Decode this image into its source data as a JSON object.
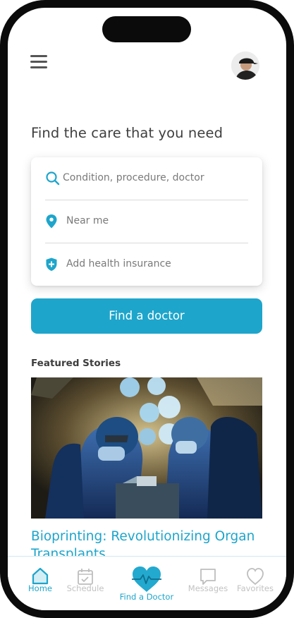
{
  "header": {
    "menu_icon": "hamburger-menu-icon",
    "avatar_icon": "user-avatar"
  },
  "main": {
    "title": "Find the care that you need",
    "search": {
      "condition_placeholder": "Condition, procedure, doctor",
      "location_placeholder": "Near me",
      "insurance_placeholder": "Add health insurance"
    },
    "find_button_label": "Find a doctor"
  },
  "featured": {
    "section_label": "Featured Stories",
    "story": {
      "image_icon": "surgeons-operating-photo",
      "title": "Bioprinting: Revolutionizing Organ Transplants"
    }
  },
  "tabbar": {
    "items": [
      {
        "label": "Home",
        "icon": "home-icon",
        "active": true
      },
      {
        "label": "Schedule",
        "icon": "calendar-check-icon",
        "active": false
      },
      {
        "label": "Find a Doctor",
        "icon": "heart-pulse-icon",
        "active": false
      },
      {
        "label": "Messages",
        "icon": "chat-bubble-icon",
        "active": false
      },
      {
        "label": "Favorites",
        "icon": "heart-icon",
        "active": false
      }
    ]
  },
  "colors": {
    "accent": "#1ea5cb",
    "text_dark": "#3f3f3f",
    "text_muted": "#7a7a7a",
    "inactive_icon": "#bdbdbd",
    "frame": "#0b0b0b"
  }
}
